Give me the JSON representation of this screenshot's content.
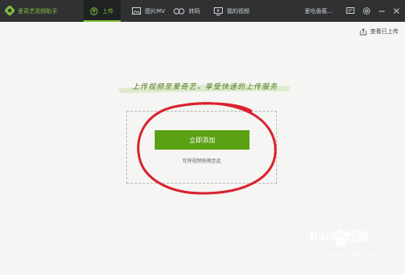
{
  "app": {
    "title": "爱奇艺视频助手"
  },
  "tabs": [
    {
      "label": "上传",
      "icon": "upload-icon"
    },
    {
      "label": "图片MV",
      "icon": "photo-mv-icon"
    },
    {
      "label": "转码",
      "icon": "transcode-icon"
    },
    {
      "label": "我的视频",
      "icon": "my-videos-icon"
    }
  ],
  "active_tab": "上传",
  "user": {
    "name": "爱吃香蕉..."
  },
  "window_controls": [
    "feedback-icon",
    "settings-icon",
    "minimize-icon",
    "close-icon"
  ],
  "content": {
    "view_uploaded": "查看已上传",
    "slogan": "上传视频至爱奇艺，享受快速的上传服务",
    "add_button": "立即添加",
    "drag_hint": "可将视频拖拽至此"
  },
  "watermark": {
    "text": "Baidu经验",
    "sub": "jingyan.baidu.com"
  },
  "colors": {
    "accent": "#5aa113",
    "titlebar": "#2f3133",
    "annotation": "#d9232e"
  }
}
